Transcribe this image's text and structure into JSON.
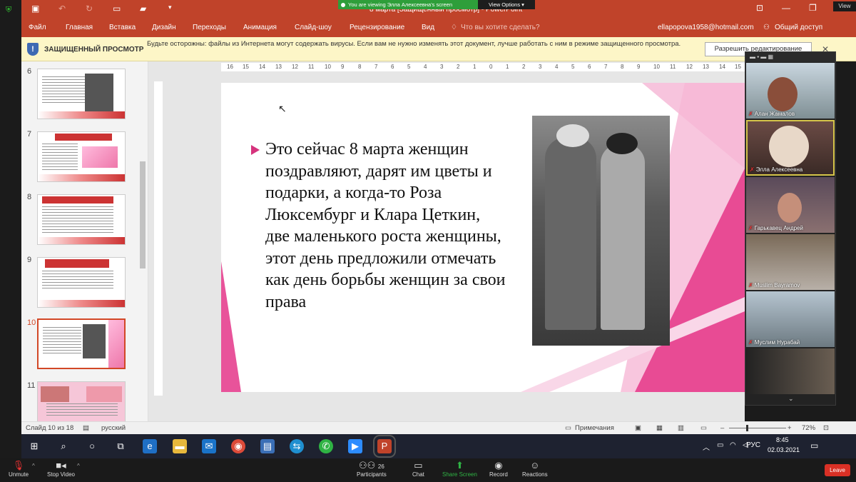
{
  "zoom": {
    "banner": "You are viewing Элла Алексеевна's screen",
    "view_options": "View Options",
    "view": "View",
    "controls": [
      {
        "icon": "mic-muted-icon",
        "label": "Unmute"
      },
      {
        "icon": "video-off-icon",
        "label": "Stop Video"
      },
      {
        "icon": "participants-icon",
        "label": "Participants",
        "count": "26"
      },
      {
        "icon": "chat-icon",
        "label": "Chat"
      },
      {
        "icon": "share-screen-icon",
        "label": "Share Screen"
      },
      {
        "icon": "record-icon",
        "label": "Record"
      },
      {
        "icon": "reactions-icon",
        "label": "Reactions"
      }
    ],
    "leave": "Leave",
    "participants": [
      {
        "name": "Алан Жамалов"
      },
      {
        "name": "Элла Алексеевна"
      },
      {
        "name": "Гарькавец Андрей"
      },
      {
        "name": "Muslim Bayramov"
      },
      {
        "name": "Муслим Нурабай"
      },
      {
        "name": ""
      }
    ]
  },
  "ppt": {
    "title": "8 марта [Защищенный просмотр] - PowerPoint",
    "ribbon": [
      "Файл",
      "Главная",
      "Вставка",
      "Дизайн",
      "Переходы",
      "Анимация",
      "Слайд-шоу",
      "Рецензирование",
      "Вид"
    ],
    "tell_me": "Что вы хотите сделать?",
    "account": "ellapopova1958@hotmail.com",
    "share": "Общий доступ",
    "protected": {
      "title": "ЗАЩИЩЕННЫЙ ПРОСМОТР",
      "message": "Будьте осторожны: файлы из Интернета могут содержать вирусы. Если вам не нужно изменять этот документ, лучше работать с ним в режиме защищенного просмотра.",
      "button": "Разрешить редактирование"
    },
    "thumbs": [
      "6",
      "7",
      "8",
      "9",
      "10",
      "11"
    ],
    "ruler": [
      "16",
      "15",
      "14",
      "13",
      "12",
      "11",
      "10",
      "9",
      "8",
      "7",
      "6",
      "5",
      "4",
      "3",
      "2",
      "1",
      "0",
      "1",
      "2",
      "3",
      "4",
      "5",
      "6",
      "7",
      "8",
      "9",
      "10",
      "11",
      "12",
      "13",
      "14",
      "15"
    ],
    "slide_text": "Это сейчас 8 марта женщин поздравляют, дарят им цветы и подарки, а когда-то Роза Люксембург и Клара Цеткин, две маленького роста женщины, этот день предложили отмечать как день борьбы женщин за свои права",
    "status": {
      "slide": "Слайд 10 из 18",
      "lang": "русский",
      "notes": "Примечания",
      "zoom": "72%"
    }
  },
  "taskbar": {
    "lang": "РУС",
    "time": "8:45",
    "date": "02.03.2021"
  }
}
